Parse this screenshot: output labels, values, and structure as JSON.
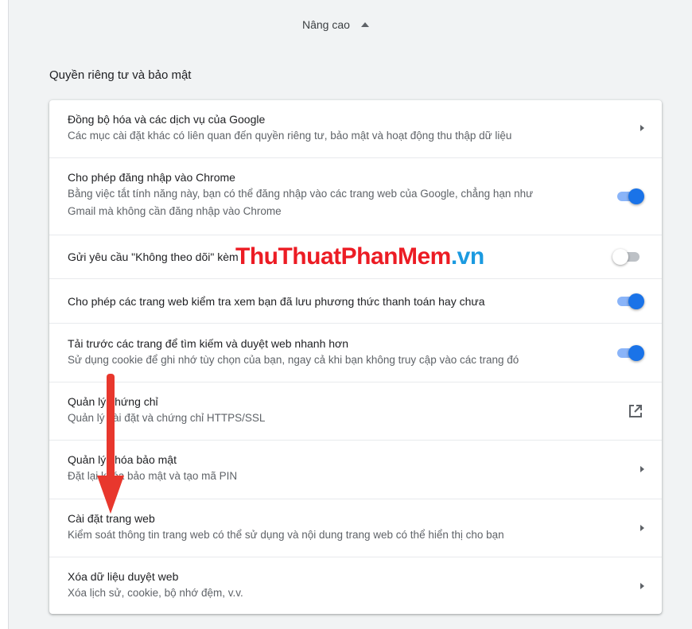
{
  "advanced": {
    "label": "Nâng cao",
    "caret_icon": "caret-up-icon"
  },
  "section": {
    "title": "Quyền riêng tư và bảo mật"
  },
  "rows": [
    {
      "title": "Đồng bộ hóa và các dịch vụ của Google",
      "subtitle": "Các mục cài đặt khác có liên quan đến quyền riêng tư, bảo mật và hoạt động thu thập dữ liệu",
      "control": "chevron"
    },
    {
      "title": "Cho phép đăng nhập vào Chrome",
      "subtitle_line1": "Bằng việc tắt tính năng này, bạn có thể đăng nhập vào các trang web của Google, chẳng hạn như",
      "subtitle_line2": "Gmail mà không cần đăng nhập vào Chrome",
      "control": "toggle",
      "toggle_state": "on"
    },
    {
      "title": "Gửi yêu cầu \"Không theo dõi\" kèm",
      "control": "toggle",
      "toggle_state": "off"
    },
    {
      "title": "Cho phép các trang web kiểm tra xem bạn đã lưu phương thức thanh toán hay chưa",
      "control": "toggle",
      "toggle_state": "on"
    },
    {
      "title": "Tải trước các trang để tìm kiếm và duyệt web nhanh hơn",
      "subtitle": "Sử dụng cookie để ghi nhớ tùy chọn của bạn, ngay cả khi bạn không truy cập vào các trang đó",
      "control": "toggle",
      "toggle_state": "on"
    },
    {
      "title": "Quản lý chứng chỉ",
      "subtitle": "Quản lý cài đặt và chứng chỉ HTTPS/SSL",
      "control": "external-link"
    },
    {
      "title": "Quản lý khóa bảo mật",
      "subtitle": "Đặt lại khóa bảo mật và tạo mã PIN",
      "control": "chevron"
    },
    {
      "title": "Cài đặt trang web",
      "subtitle": "Kiểm soát thông tin trang web có thể sử dụng và nội dung trang web có thể hiển thị cho bạn",
      "control": "chevron"
    },
    {
      "title": "Xóa dữ liệu duyệt web",
      "subtitle": "Xóa lịch sử, cookie, bộ nhớ đệm, v.v.",
      "control": "chevron"
    }
  ],
  "watermark": {
    "part1": "ThuThuat",
    "part2": "PhanMem",
    "part3": ".vn"
  },
  "colors": {
    "toggle_on": "#1a73e8",
    "toggle_track_on": "#8ab4f8",
    "toggle_off": "#bdc1c6",
    "arrow": "#e8372d",
    "watermark_red": "#ec1c24",
    "watermark_blue": "#1b9ae0"
  }
}
